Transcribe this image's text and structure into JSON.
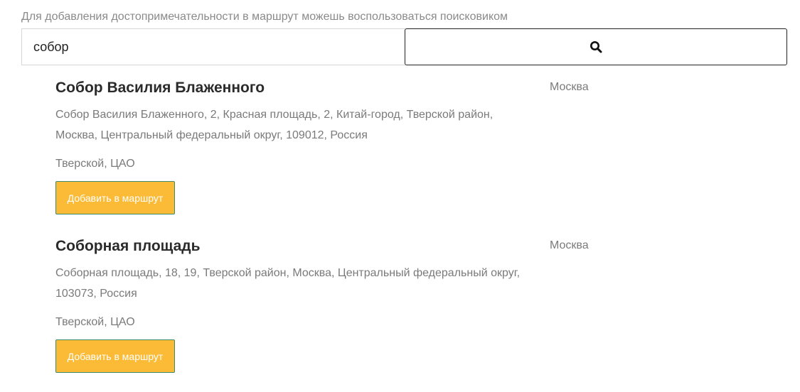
{
  "search": {
    "hint": "Для добавления достопримечательности в маршрут можешь воспользоваться поисковиком",
    "query": "собор",
    "button_icon": "search-icon"
  },
  "results": [
    {
      "title": "Собор Василия Блаженного",
      "city": "Москва",
      "address": "Собор Василия Блаженного, 2, Красная площадь, 2, Китай-город, Тверской район, Москва, Центральный федеральный округ, 109012, Россия",
      "district": "Тверской, ЦАО",
      "add_label": "Добавить в маршрут"
    },
    {
      "title": "Соборная площадь",
      "city": "Москва",
      "address": "Соборная площадь, 18, 19, Тверской район, Москва, Центральный федеральный округ, 103073, Россия",
      "district": "Тверской, ЦАО",
      "add_label": "Добавить в маршрут"
    }
  ],
  "colors": {
    "add_button_bg": "#fbbb36",
    "add_button_border": "#3b8a6c",
    "text_muted": "#7a7a7a",
    "title_text": "#2b2b2b"
  }
}
